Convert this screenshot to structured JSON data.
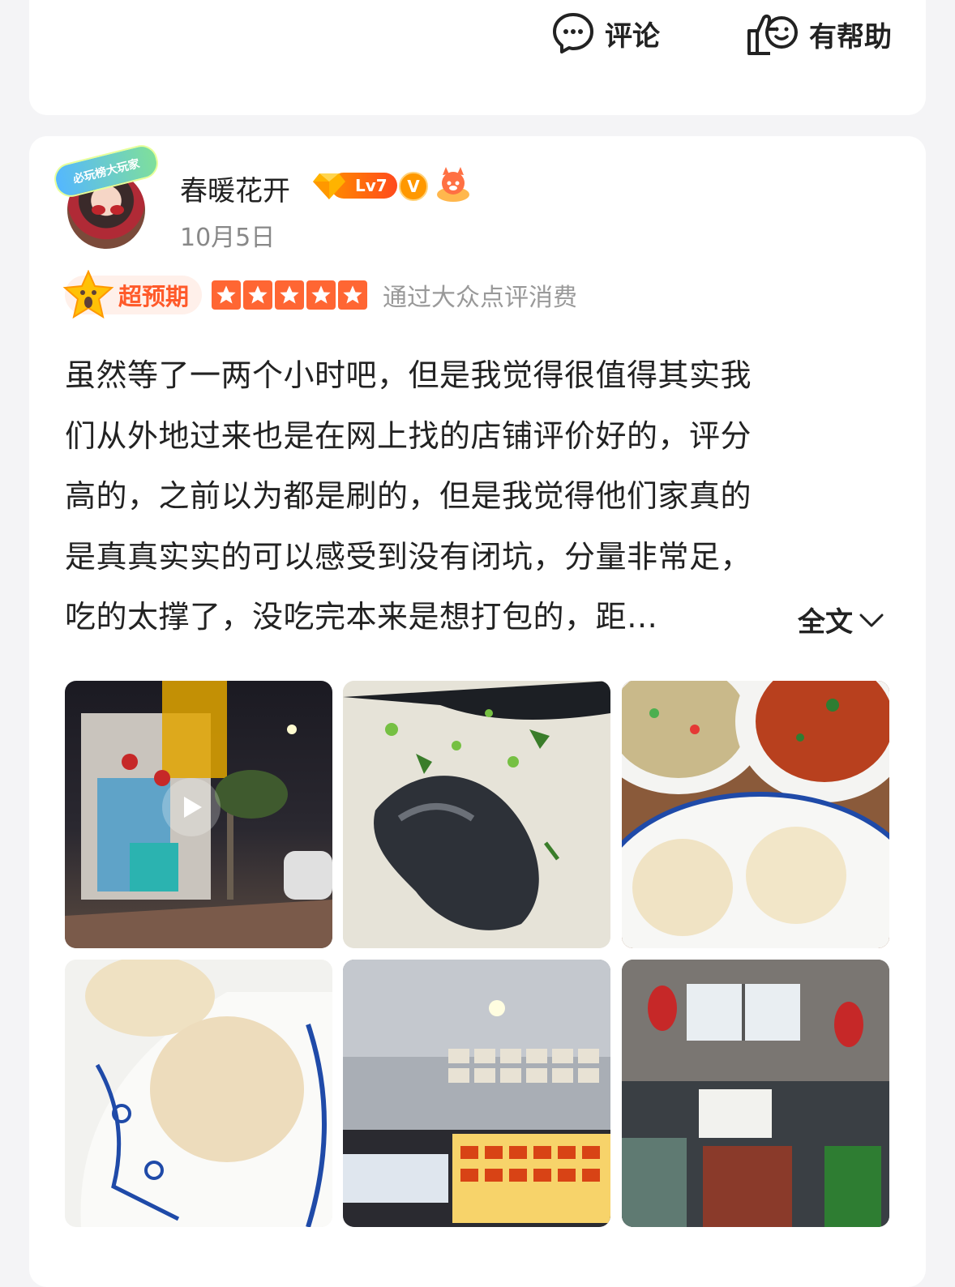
{
  "actions": {
    "comment_label": "评论",
    "helpful_label": "有帮助"
  },
  "review": {
    "avatar_frame_text": "必玩榜大玩家",
    "username": "春暖花开",
    "level": "Lv7",
    "verified": "V",
    "date": "10月5日",
    "rating_tag": "超预期",
    "stars": 5,
    "consume_note": "通过大众点评消费",
    "text_lines": [
      "虽然等了一两个小时吧，但是我觉得很值得其实我",
      "们从外地过来也是在网上找的店铺评价好的，评分",
      "高的，之前以为都是刷的，但是我觉得他们家真的",
      "是真真实实的可以感受到没有闭坑，分量非常足，",
      "吃的太撑了，没吃完本来是想打包的，距…"
    ],
    "expand_label": "全文"
  },
  "colors": {
    "accent": "#ff6633",
    "tag_text": "#ff5a2a",
    "secondary_text": "#888888"
  }
}
